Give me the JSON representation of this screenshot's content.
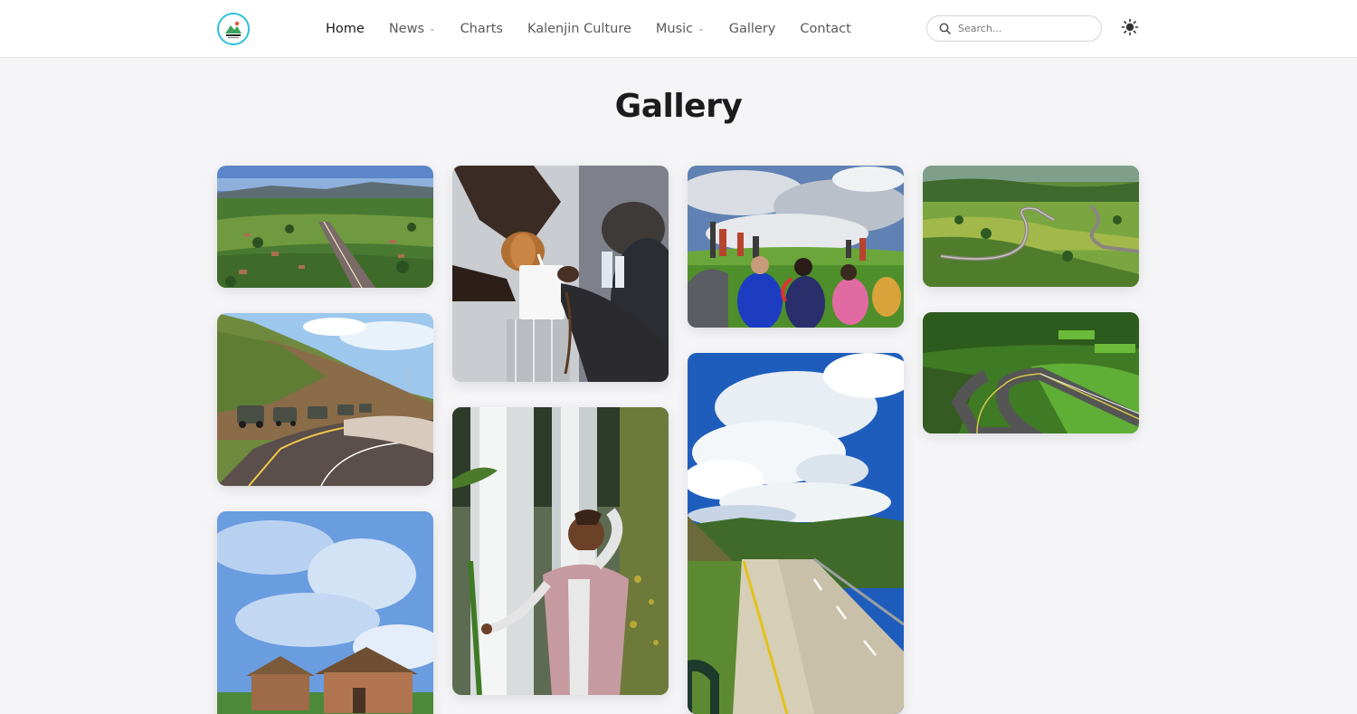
{
  "nav": {
    "items": [
      {
        "label": "Home",
        "active": true,
        "dropdown": false
      },
      {
        "label": "News",
        "active": false,
        "dropdown": true
      },
      {
        "label": "Charts",
        "active": false,
        "dropdown": false
      },
      {
        "label": "Kalenjin Culture",
        "active": false,
        "dropdown": false
      },
      {
        "label": "Music",
        "active": false,
        "dropdown": true
      },
      {
        "label": "Gallery",
        "active": false,
        "dropdown": false
      },
      {
        "label": "Contact",
        "active": false,
        "dropdown": false
      }
    ],
    "chevron": "⌄"
  },
  "search": {
    "placeholder": "Search...",
    "value": "",
    "icon": "search-icon"
  },
  "theme_toggle": {
    "icon": "sun-icon"
  },
  "page": {
    "title": "Gallery"
  },
  "gallery": {
    "photos": [
      {
        "name": "aerial-road-village-photo",
        "scene": "aerial view of a road through a rural village with mountains"
      },
      {
        "name": "pouring-milk-gourd-photo",
        "scene": "hands pouring milk from a traditional gourd into a cup"
      },
      {
        "name": "people-seated-hillside-photo",
        "scene": "group of people sitting on grass under a cloudy sky"
      },
      {
        "name": "winding-valley-road-photo",
        "scene": "winding road through green valley farmland"
      },
      {
        "name": "convoy-on-hill-road-photo",
        "scene": "convoy of safari vehicles on a curving hill road"
      },
      {
        "name": "woman-at-waterfall-photo",
        "scene": "smiling woman posing in front of a waterfall"
      },
      {
        "name": "clouds-over-highway-photo",
        "scene": "tall cumulus clouds over a highway"
      },
      {
        "name": "green-escarpment-road-photo",
        "scene": "highway along a green escarpment"
      },
      {
        "name": "thatched-huts-sky-photo",
        "scene": "traditional thatched huts under a blue sky"
      }
    ]
  },
  "colors": {
    "accent": "#2cc0d8",
    "title": "#1c1c1c",
    "nav_text": "#5a5a5a",
    "background": "#f5f5f7"
  }
}
